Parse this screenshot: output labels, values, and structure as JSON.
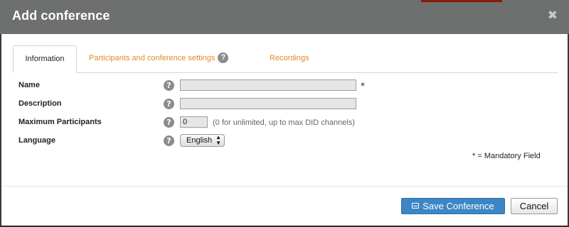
{
  "dialog": {
    "title": "Add conference",
    "close_glyph": "✖"
  },
  "tabs": [
    {
      "label": "Information",
      "active": true
    },
    {
      "label": "Participants and conference settings",
      "active": false,
      "has_help": true
    },
    {
      "label": "Recordings",
      "active": false
    }
  ],
  "help_glyph": "?",
  "form": {
    "name": {
      "label": "Name",
      "value": "",
      "required_mark": "*"
    },
    "description": {
      "label": "Description",
      "value": ""
    },
    "max_participants": {
      "label": "Maximum Participants",
      "value": "0",
      "hint": "(0 for unlimited, up to max DID channels)"
    },
    "language": {
      "label": "Language",
      "selected": "English",
      "arrow": "▲▼"
    }
  },
  "mandatory_note": "* = Mandatory Field",
  "buttons": {
    "save": "Save Conference",
    "cancel": "Cancel"
  },
  "colors": {
    "header_bg": "#6d706e",
    "tab_link": "#e08a22",
    "primary_button": "#3d86c6"
  }
}
